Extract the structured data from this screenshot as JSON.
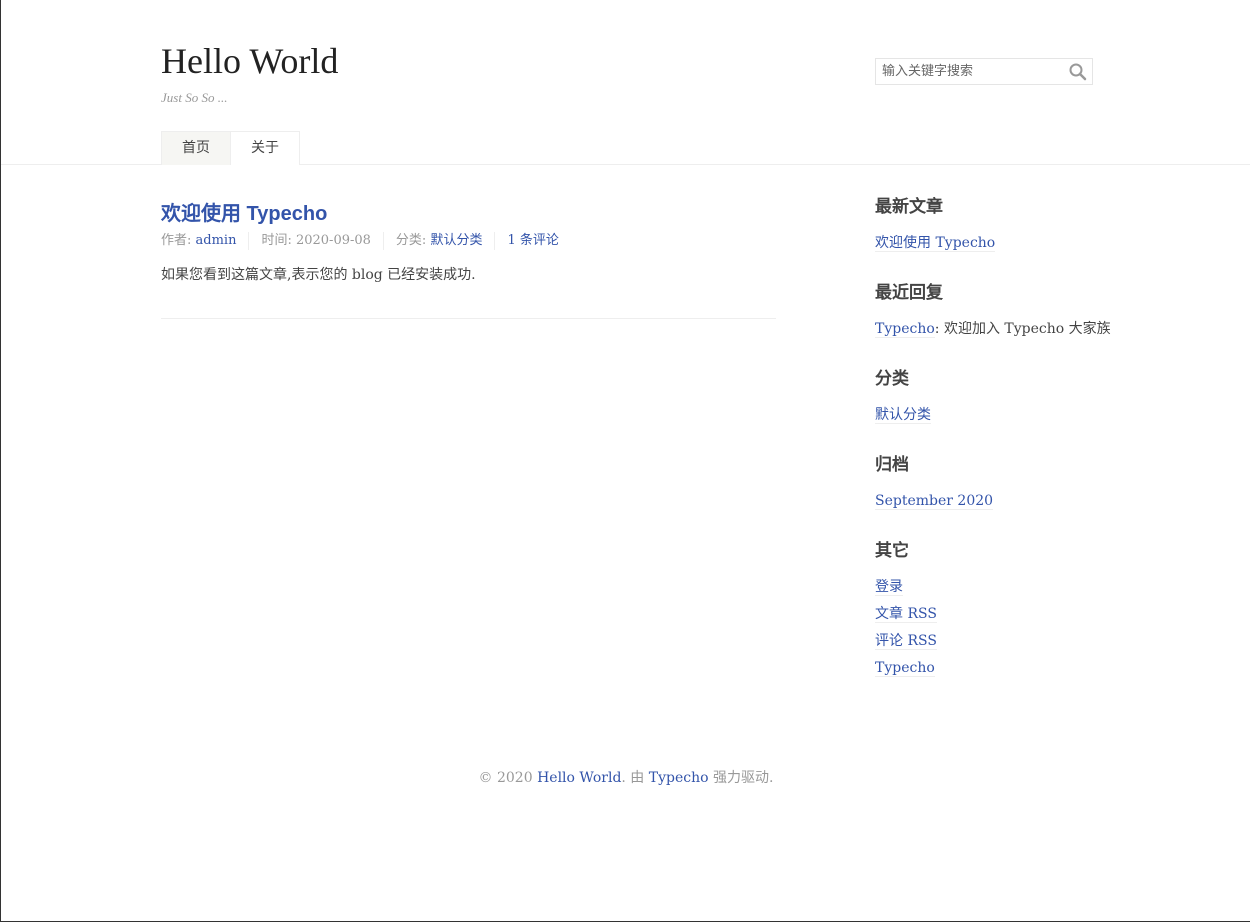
{
  "header": {
    "site_title": "Hello World",
    "site_desc": "Just So So ...",
    "search_placeholder": "输入关键字搜索",
    "nav": [
      {
        "label": "首页",
        "current": true
      },
      {
        "label": "关于",
        "current": false
      }
    ]
  },
  "post": {
    "title": "欢迎使用 Typecho",
    "meta": {
      "author_label": "作者: ",
      "author": "admin",
      "time_label": "时间: ",
      "time": "2020-09-08",
      "category_label": "分类: ",
      "category": "默认分类",
      "comments": "1 条评论"
    },
    "content": "如果您看到这篇文章,表示您的 blog 已经安装成功."
  },
  "sidebar": {
    "recent_posts": {
      "title": "最新文章",
      "items": [
        "欢迎使用 Typecho"
      ]
    },
    "recent_comments": {
      "title": "最近回复",
      "author": "Typecho",
      "text": ": 欢迎加入 Typecho 大家族"
    },
    "categories": {
      "title": "分类",
      "items": [
        "默认分类"
      ]
    },
    "archives": {
      "title": "归档",
      "items": [
        "September 2020"
      ]
    },
    "misc": {
      "title": "其它",
      "items": [
        "登录",
        "文章 RSS",
        "评论 RSS",
        "Typecho"
      ]
    }
  },
  "footer": {
    "copyright": "© 2020 ",
    "site_link": "Hello World",
    "by": ". 由 ",
    "typecho_link": "Typecho",
    "powered": " 强力驱动."
  },
  "colors": {
    "link": "#3354AA",
    "text": "#444444",
    "muted": "#999999",
    "border": "#eeeeee"
  },
  "icons": {
    "search": "search-icon"
  }
}
